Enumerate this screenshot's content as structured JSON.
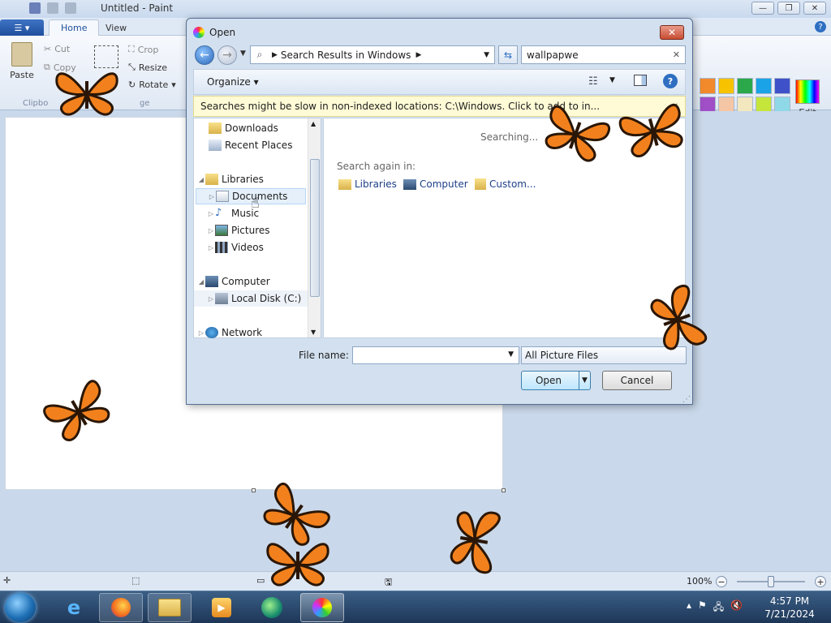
{
  "paint": {
    "window_title": "Untitled - Paint",
    "tabs": {
      "home": "Home",
      "view": "View"
    },
    "ribbon": {
      "paste": "Paste",
      "cut": "Cut",
      "copy": "Copy",
      "crop": "Crop",
      "resize": "Resize",
      "rotate": "Rotate",
      "clipboard_group": "Clipbo",
      "image_group": "ge",
      "edit_colors": "Edit colors"
    },
    "palette": [
      "#f28a2b",
      "#f7c300",
      "#2aa84a",
      "#1aa3e6",
      "#3f51c9",
      "#a04fc7",
      "#f5c6a5",
      "#f2e7bf",
      "#c6e53b",
      "#8fd8e8",
      "#6c8fcb",
      "#cab8e0",
      "#ffffff",
      "#ffffff",
      "#ffffff",
      "#ffffff",
      "#ffffff"
    ],
    "status": {
      "zoom": "100%"
    }
  },
  "dialog": {
    "title": "Open",
    "breadcrumb": {
      "location": "Search Results in Windows"
    },
    "search_value": "wallpapwe",
    "organize": "Organize",
    "info_bar": "Searches might be slow in non-indexed locations: C:\\Windows. Click to add to in...",
    "nav": {
      "downloads": "Downloads",
      "recent_places": "Recent Places",
      "libraries": "Libraries",
      "documents": "Documents",
      "music": "Music",
      "pictures": "Pictures",
      "videos": "Videos",
      "computer": "Computer",
      "local_disk": "Local Disk (C:)",
      "network": "Network"
    },
    "results": {
      "searching": "Searching...",
      "search_again": "Search again in:",
      "libraries": "Libraries",
      "computer": "Computer",
      "custom": "Custom..."
    },
    "file_name_label": "File name:",
    "file_name_value": "",
    "filter": "All Picture Files",
    "open_button": "Open",
    "cancel_button": "Cancel"
  },
  "taskbar": {
    "time": "4:57 PM",
    "date": "7/21/2024"
  }
}
